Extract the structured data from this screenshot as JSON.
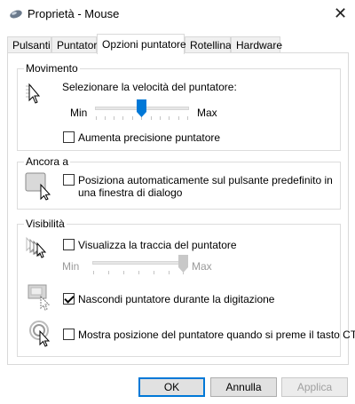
{
  "window": {
    "title": "Proprietà - Mouse",
    "close_glyph": "✕",
    "icon": "mouse-icon"
  },
  "tabs": [
    {
      "label": "Pulsanti"
    },
    {
      "label": "Puntatori"
    },
    {
      "label": "Opzioni puntatore",
      "active": true
    },
    {
      "label": "Rotellina"
    },
    {
      "label": "Hardware"
    }
  ],
  "movimento": {
    "label": "Movimento",
    "speed_label": "Selezionare la velocità del puntatore:",
    "min": "Min",
    "max": "Max",
    "speed_value": 0.5,
    "precision_label": "Aumenta precisione puntatore",
    "precision_checked": false
  },
  "ancora": {
    "label": "Ancora a",
    "snap_label_line1": "Posiziona automaticamente sul pulsante predefinito in",
    "snap_label_line2": "una finestra di dialogo",
    "snap_checked": false
  },
  "visibilita": {
    "label": "Visibilità",
    "trail_label": "Visualizza la traccia del puntatore",
    "trail_checked": false,
    "trail_min": "Min",
    "trail_max": "Max",
    "trail_value": 1.0,
    "hide_label": "Nascondi puntatore durante la digitazione",
    "hide_checked": true,
    "ctrl_label": "Mostra posizione del puntatore quando si preme il tasto CTRL",
    "ctrl_checked": false
  },
  "buttons": {
    "ok": "OK",
    "cancel": "Annulla",
    "apply": "Applica"
  },
  "colors": {
    "accent": "#0078d7"
  }
}
